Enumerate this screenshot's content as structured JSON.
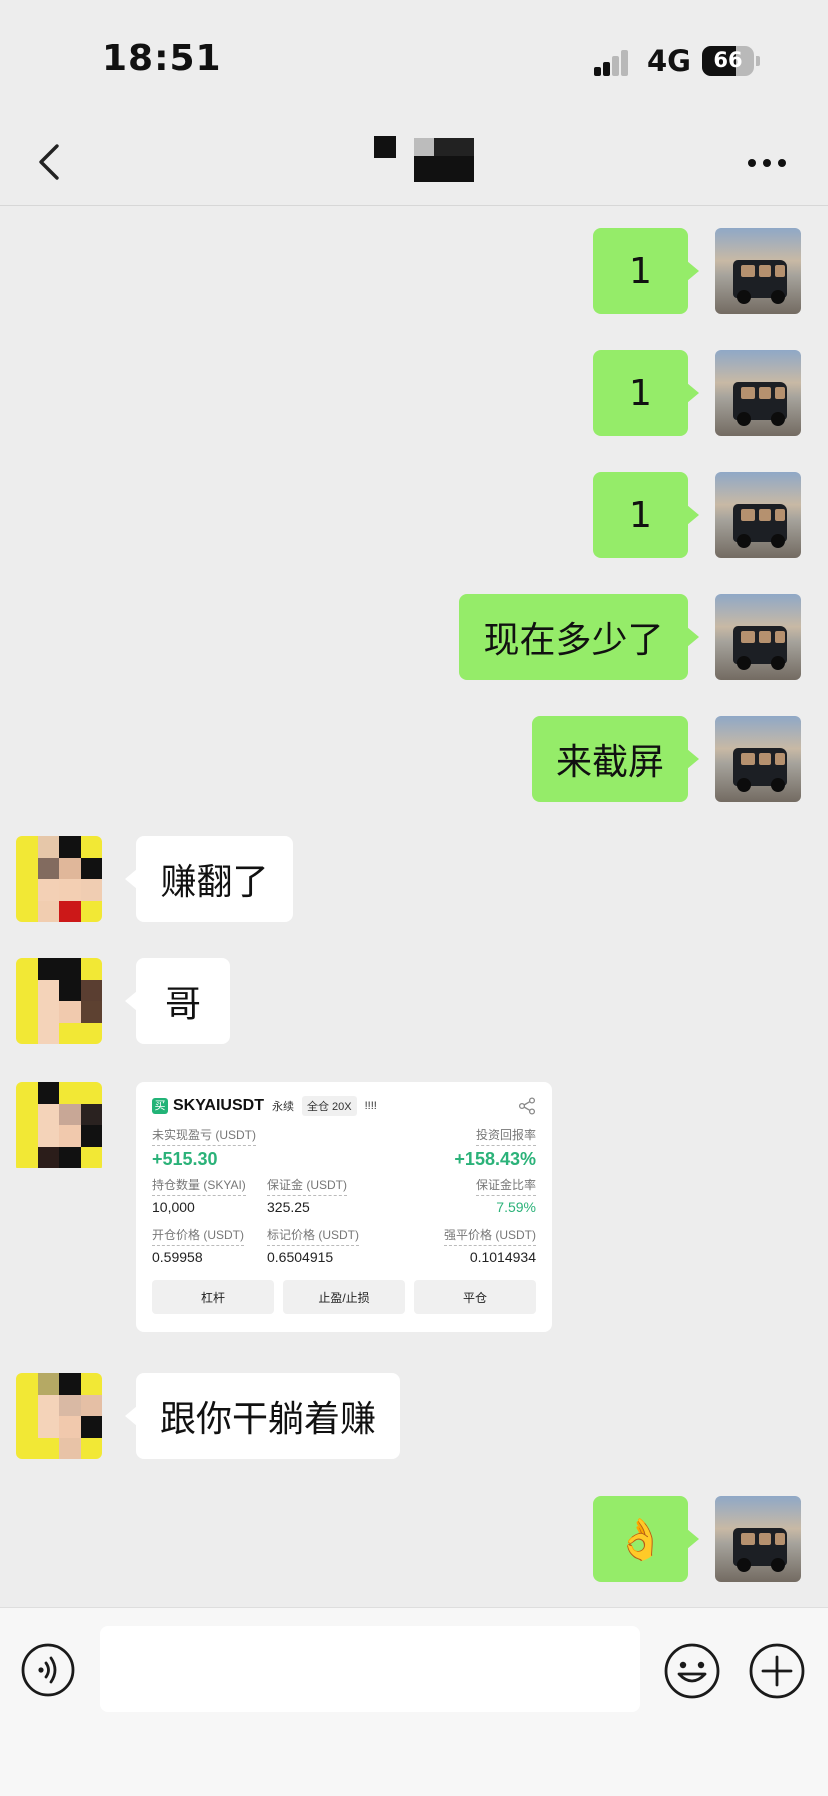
{
  "status": {
    "time": "18:51",
    "network": "4G",
    "battery": "66",
    "battery_level": 0.66
  },
  "header": {
    "back_icon": "chevron-left-icon",
    "more_icon": "more-dots-icon"
  },
  "messages": [
    {
      "side": "right",
      "text": "1"
    },
    {
      "side": "right",
      "text": "1"
    },
    {
      "side": "right",
      "text": "1"
    },
    {
      "side": "right",
      "text": "现在多少了"
    },
    {
      "side": "right",
      "text": "来截屏"
    },
    {
      "side": "left",
      "text": "赚翻了"
    },
    {
      "side": "left",
      "text": "哥"
    },
    {
      "side": "left",
      "type": "card"
    },
    {
      "side": "left",
      "text": "跟你干躺着赚"
    },
    {
      "side": "right",
      "text": "👌"
    }
  ],
  "card": {
    "badge": "买",
    "symbol": "SKYAIUSDT",
    "tag1": "永续",
    "tag2": "全仓 20X",
    "tag3": "!!!!",
    "pnl_label": "未实现盈亏 (USDT)",
    "pnl_value": "+515.30",
    "roi_label": "投资回报率",
    "roi_value": "+158.43%",
    "size_label": "持仓数量 (SKYAI)",
    "size_value": "10,000",
    "margin_label": "保证金 (USDT)",
    "margin_value": "325.25",
    "margin_ratio_label": "保证金比率",
    "margin_ratio_value": "7.59%",
    "entry_label": "开仓价格 (USDT)",
    "entry_value": "0.59958",
    "mark_label": "标记价格 (USDT)",
    "mark_value": "0.6504915",
    "liq_label": "强平价格 (USDT)",
    "liq_value": "0.1014934",
    "btn_leverage": "杠杆",
    "btn_tpsl": "止盈/止损",
    "btn_close": "平仓"
  },
  "input": {
    "value": "",
    "placeholder": ""
  }
}
